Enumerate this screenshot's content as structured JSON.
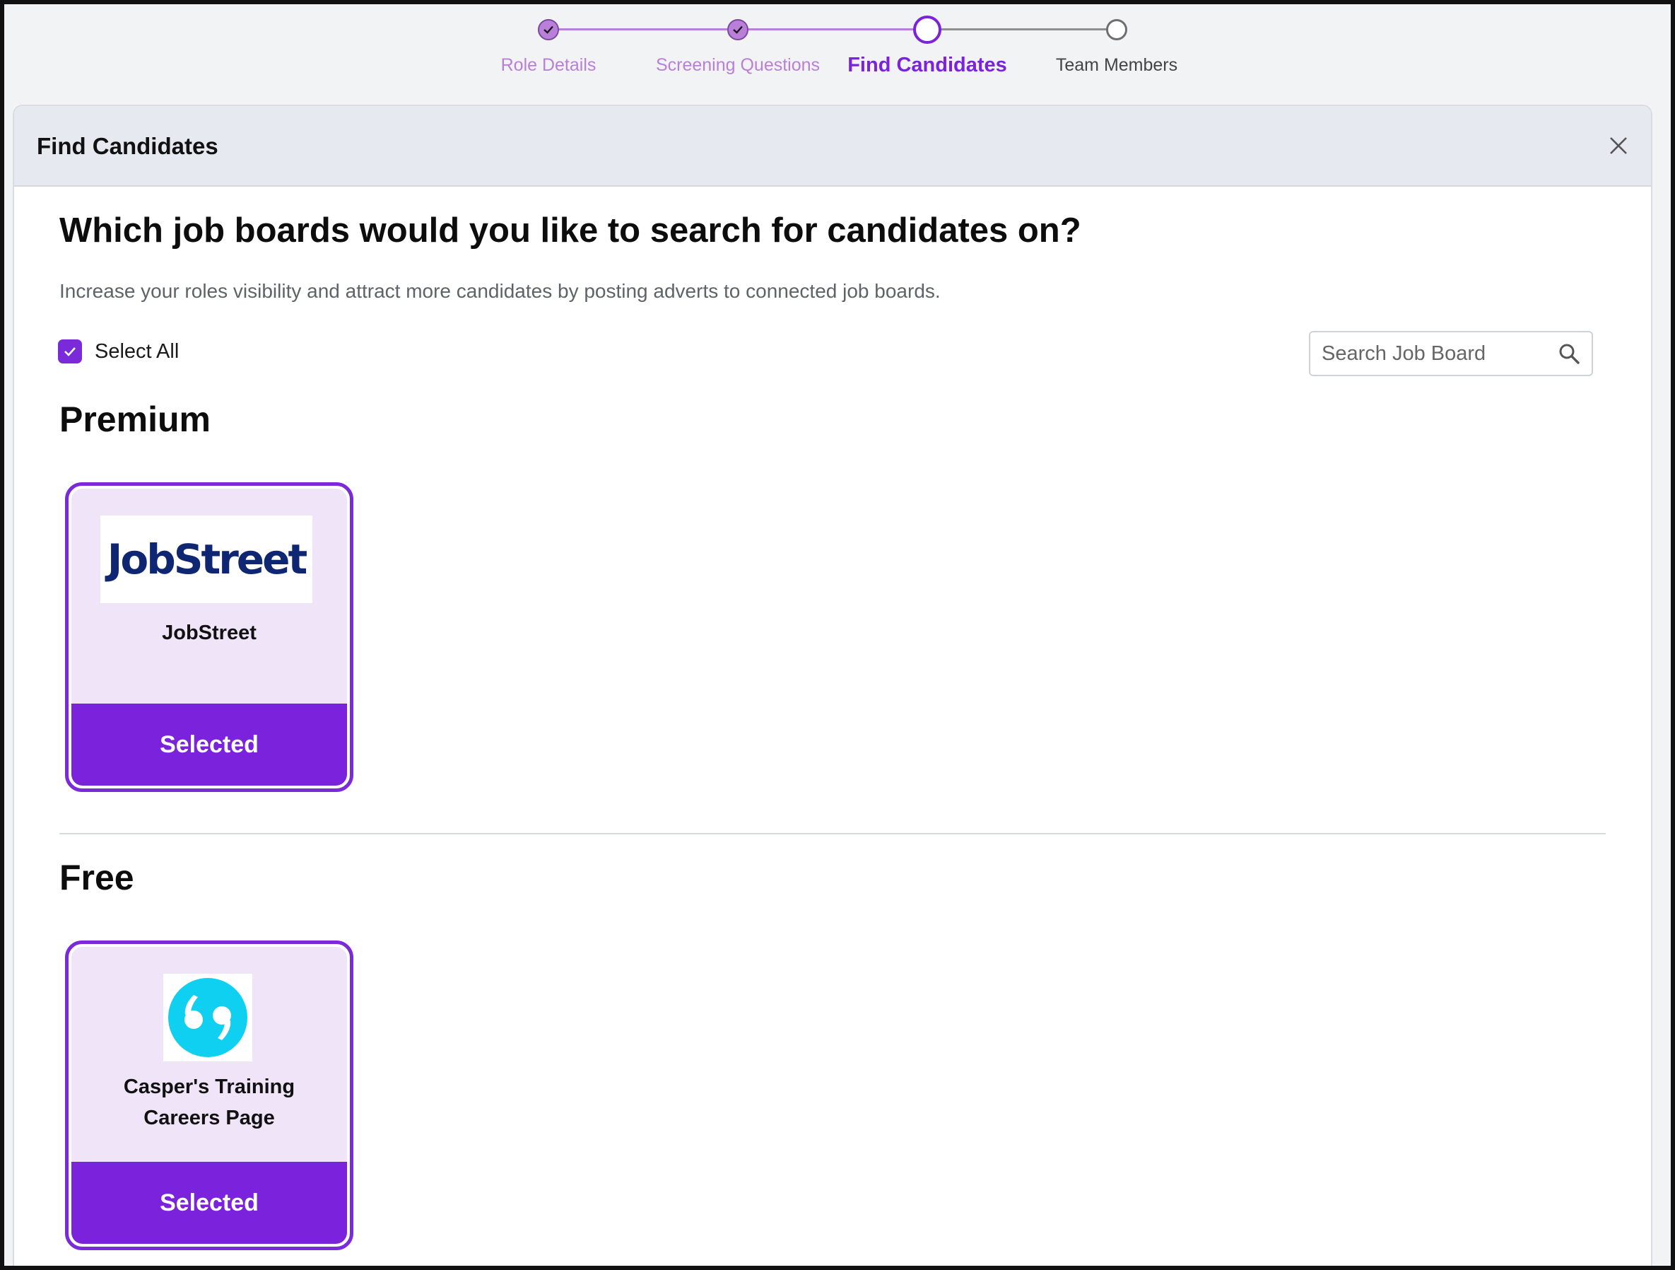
{
  "stepper": {
    "steps": [
      {
        "label": "Role Details",
        "state": "completed"
      },
      {
        "label": "Screening Questions",
        "state": "completed"
      },
      {
        "label": "Find Candidates",
        "state": "active"
      },
      {
        "label": "Team Members",
        "state": "pending"
      }
    ]
  },
  "panel": {
    "title": "Find Candidates",
    "close_icon": "close-icon"
  },
  "main": {
    "question": "Which job boards would you like to search for candidates on?",
    "subtitle": "Increase your roles visibility and attract more candidates by posting adverts to connected job boards.",
    "select_all_label": "Select All",
    "select_all_checked": true,
    "search_placeholder": "Search Job Board"
  },
  "sections": [
    {
      "heading": "Premium",
      "boards": [
        {
          "name": "JobStreet",
          "logo_text": "JobStreet",
          "button": "Selected"
        }
      ]
    },
    {
      "heading": "Free",
      "boards": [
        {
          "name_line1": "Casper's Training",
          "name_line2": "Careers Page",
          "button": "Selected"
        }
      ]
    }
  ],
  "colors": {
    "accent": "#7a22dc",
    "completed_step": "#b97fd9",
    "card_bg": "#efe4f8",
    "jobstreet_blue": "#0f2672",
    "casper_cyan": "#0fd0f0"
  }
}
